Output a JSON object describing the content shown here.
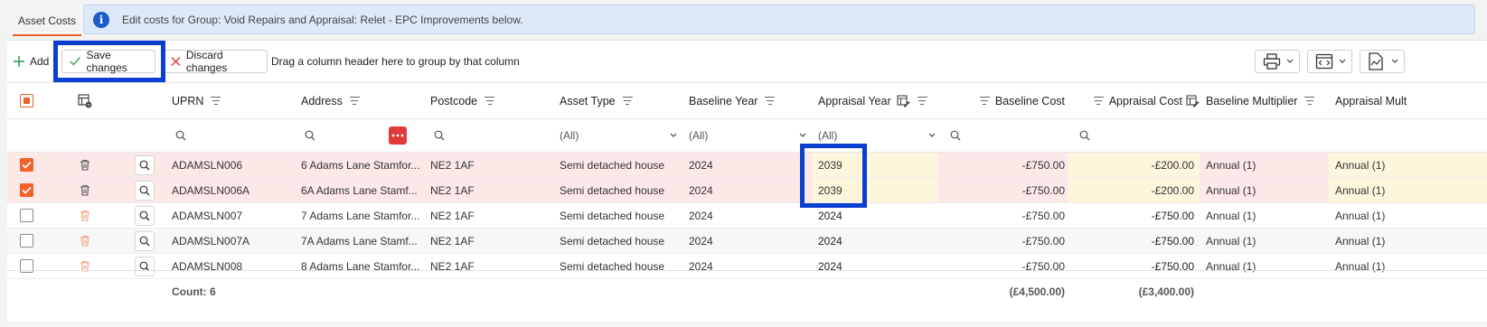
{
  "tab": {
    "label": "Asset Costs"
  },
  "banner": {
    "text": "Edit costs for Group: Void Repairs and Appraisal: Relet - EPC Improvements below."
  },
  "toolbar": {
    "add_label": "Add",
    "save_label": "Save changes",
    "discard_label": "Discard changes",
    "group_hint": "Drag a column header here to group by that column"
  },
  "columns": {
    "uprn": "UPRN",
    "address": "Address",
    "postcode": "Postcode",
    "asset_type": "Asset Type",
    "baseline_year": "Baseline Year",
    "appraisal_year": "Appraisal Year",
    "baseline_cost": "Baseline Cost",
    "appraisal_cost": "Appraisal Cost",
    "baseline_multiplier": "Baseline Multiplier",
    "appraisal_multiplier": "Appraisal Mult"
  },
  "filters": {
    "asset_type": "(All)",
    "baseline_year": "(All)",
    "appraisal_year": "(All)"
  },
  "rows": [
    {
      "selected": true,
      "modified": true,
      "uprn": "ADAMSLN006",
      "address": "6 Adams Lane Stamfor...",
      "postcode": "NE2 1AF",
      "asset_type": "Semi detached house",
      "baseline_year": "2024",
      "appraisal_year": "2039",
      "baseline_cost": "-£750.00",
      "appraisal_cost": "-£200.00",
      "baseline_multiplier": "Annual (1)",
      "appraisal_multiplier": "Annual (1)"
    },
    {
      "selected": true,
      "modified": true,
      "uprn": "ADAMSLN006A",
      "address": "6A Adams Lane Stamf...",
      "postcode": "NE2 1AF",
      "asset_type": "Semi detached house",
      "baseline_year": "2024",
      "appraisal_year": "2039",
      "baseline_cost": "-£750.00",
      "appraisal_cost": "-£200.00",
      "baseline_multiplier": "Annual (1)",
      "appraisal_multiplier": "Annual (1)"
    },
    {
      "selected": false,
      "modified": false,
      "uprn": "ADAMSLN007",
      "address": "7 Adams Lane Stamfor...",
      "postcode": "NE2 1AF",
      "asset_type": "Semi detached house",
      "baseline_year": "2024",
      "appraisal_year": "2024",
      "baseline_cost": "-£750.00",
      "appraisal_cost": "-£750.00",
      "baseline_multiplier": "Annual (1)",
      "appraisal_multiplier": "Annual (1)"
    },
    {
      "selected": false,
      "modified": false,
      "uprn": "ADAMSLN007A",
      "address": "7A Adams Lane Stamf...",
      "postcode": "NE2 1AF",
      "asset_type": "Semi detached house",
      "baseline_year": "2024",
      "appraisal_year": "2024",
      "baseline_cost": "-£750.00",
      "appraisal_cost": "-£750.00",
      "baseline_multiplier": "Annual (1)",
      "appraisal_multiplier": "Annual (1)"
    },
    {
      "selected": false,
      "modified": false,
      "uprn": "ADAMSLN008",
      "address": "8 Adams Lane Stamfor...",
      "postcode": "NE2 1AF",
      "asset_type": "Semi detached house",
      "baseline_year": "2024",
      "appraisal_year": "2024",
      "baseline_cost": "-£750.00",
      "appraisal_cost": "-£750.00",
      "baseline_multiplier": "Annual (1)",
      "appraisal_multiplier": "Annual (1)"
    }
  ],
  "footer": {
    "count": "Count: 6",
    "baseline_total": "(£4,500.00)",
    "appraisal_total": "(£3,400.00)"
  },
  "colors": {
    "accent": "#e8622c",
    "highlight": "#0a3fd1",
    "modified_row": "#fde8e8",
    "edited_cell": "#fdf5dc"
  }
}
